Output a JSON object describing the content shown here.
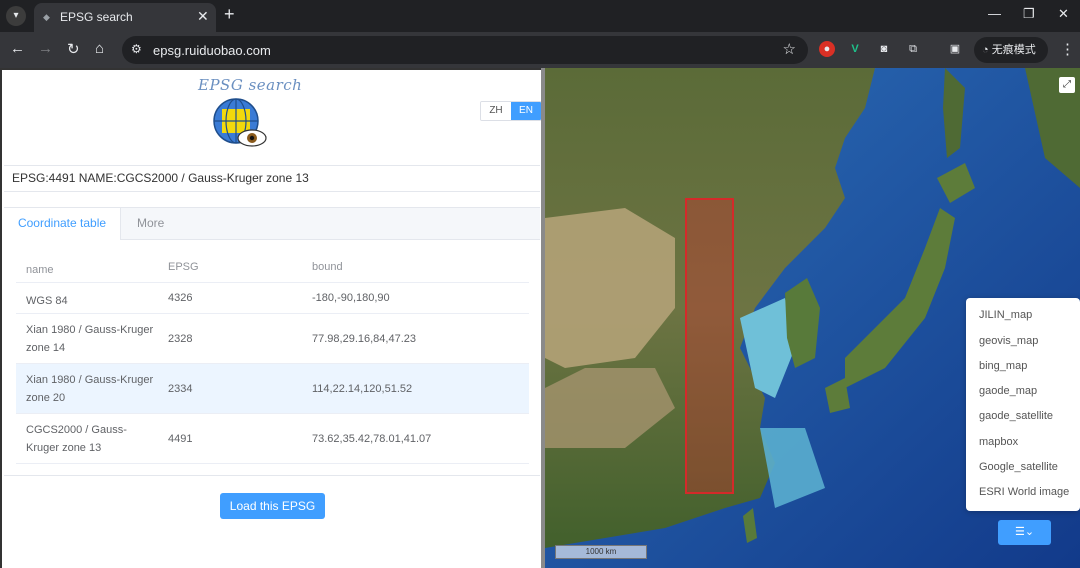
{
  "browser": {
    "tab_title": "EPSG search",
    "url": "epsg.ruiduobao.com",
    "incognito_label": "无痕模式"
  },
  "app": {
    "logo_title": "EPSG search",
    "lang_zh": "ZH",
    "lang_en": "EN",
    "epsg_info": "EPSG:4491 NAME:CGCS2000 / Gauss-Kruger zone 13",
    "tabs": [
      "Coordinate table",
      "More"
    ],
    "table": {
      "headers": [
        "name",
        "EPSG",
        "bound"
      ],
      "rows": [
        {
          "name": "WGS 84",
          "epsg": "4326",
          "bound": "-180,-90,180,90"
        },
        {
          "name": "Xian 1980 / Gauss-Kruger zone 14",
          "epsg": "2328",
          "bound": "77.98,29.16,84,47.23"
        },
        {
          "name": "Xian 1980 / Gauss-Kruger zone 20",
          "epsg": "2334",
          "bound": "114,22.14,120,51.52"
        },
        {
          "name": "CGCS2000 / Gauss-Kruger zone 13",
          "epsg": "4491",
          "bound": "73.62,35.42,78.01,41.07"
        }
      ]
    },
    "load_button": "Load this EPSG"
  },
  "map": {
    "layers": [
      "JILIN_map",
      "geovis_map",
      "bing_map",
      "gaode_map",
      "gaode_satellite",
      "mapbox",
      "Google_satellite",
      "ESRI World image"
    ],
    "scale_label": "1000 km",
    "highlight_color": "#d42a2a"
  }
}
